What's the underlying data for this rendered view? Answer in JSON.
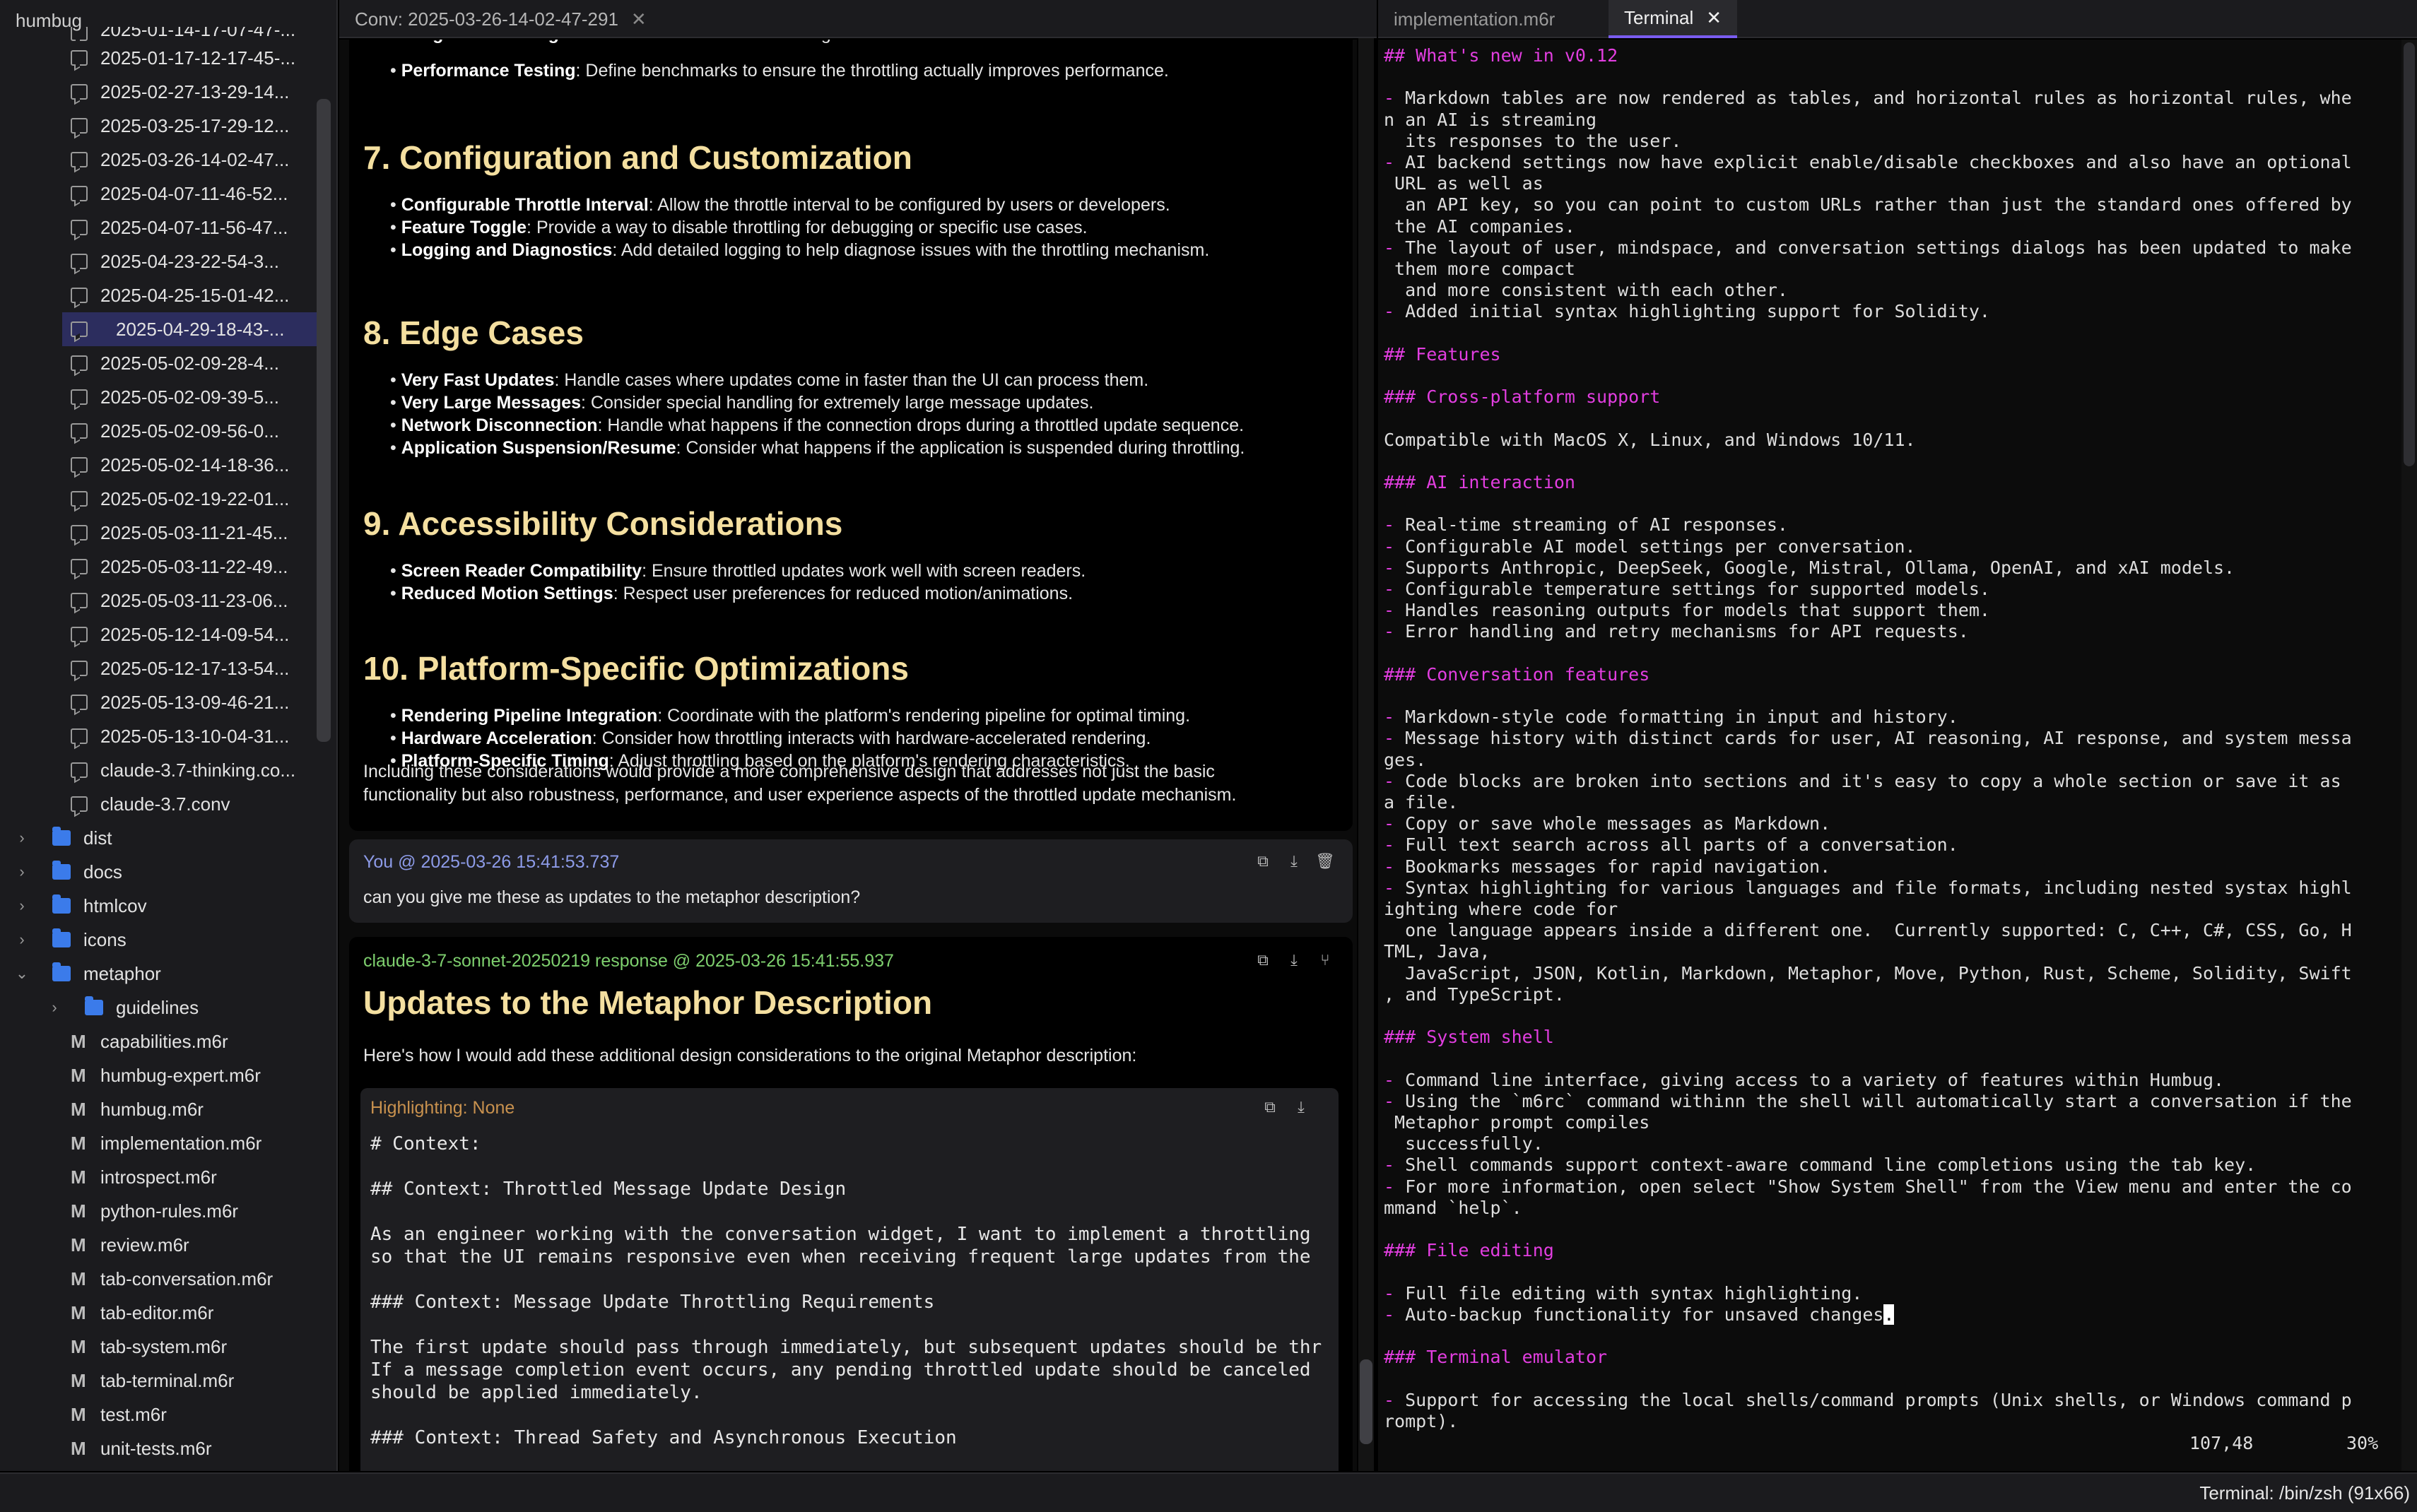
{
  "app": {
    "title": "humbug"
  },
  "sidebar": {
    "conversations": [
      "2025-01-14-17-07-47-...",
      "2025-01-17-12-17-45-...",
      "2025-02-27-13-29-14...",
      "2025-03-25-17-29-12...",
      "2025-03-26-14-02-47...",
      "2025-04-07-11-46-52...",
      "2025-04-07-11-56-47...",
      "2025-04-23-22-54-3...",
      "2025-04-25-15-01-42...",
      "2025-04-29-18-43-...",
      "2025-05-02-09-28-4...",
      "2025-05-02-09-39-5...",
      "2025-05-02-09-56-0...",
      "2025-05-02-14-18-36...",
      "2025-05-02-19-22-01...",
      "2025-05-03-11-21-45...",
      "2025-05-03-11-22-49...",
      "2025-05-03-11-23-06...",
      "2025-05-12-14-09-54...",
      "2025-05-12-17-13-54...",
      "2025-05-13-09-46-21...",
      "2025-05-13-10-04-31...",
      "claude-3.7-thinking.co...",
      "claude-3.7.conv"
    ],
    "folders": [
      "dist",
      "docs",
      "htmlcov",
      "icons"
    ],
    "open_folder": "metaphor",
    "subfolder": "guidelines",
    "files": [
      "capabilities.m6r",
      "humbug-expert.m6r",
      "humbug.m6r",
      "implementation.m6r",
      "introspect.m6r",
      "python-rules.m6r",
      "review.m6r",
      "tab-conversation.m6r",
      "tab-editor.m6r",
      "tab-system.m6r",
      "tab-terminal.m6r",
      "test.m6r",
      "unit-tests.m6r"
    ],
    "file_icon": "M"
  },
  "conv_tab": {
    "label": "Conv: 2025-03-26-14-02-47-291",
    "close": "✕"
  },
  "conversation": {
    "top_bullets": [
      {
        "b": "Integration Testing",
        "t": ": Describe how to test the throttling with the rest of the UI."
      },
      {
        "b": "Performance Testing",
        "t": ": Define benchmarks to ensure the throttling actually improves performance."
      }
    ],
    "sections": [
      {
        "title": "7. Configuration and Customization",
        "bullets": [
          {
            "b": "Configurable Throttle Interval",
            "t": ": Allow the throttle interval to be configured by users or developers."
          },
          {
            "b": "Feature Toggle",
            "t": ": Provide a way to disable throttling for debugging or specific use cases."
          },
          {
            "b": "Logging and Diagnostics",
            "t": ": Add detailed logging to help diagnose issues with the throttling mechanism."
          }
        ]
      },
      {
        "title": "8. Edge Cases",
        "bullets": [
          {
            "b": "Very Fast Updates",
            "t": ": Handle cases where updates come in faster than the UI can process them."
          },
          {
            "b": "Very Large Messages",
            "t": ": Consider special handling for extremely large message updates."
          },
          {
            "b": "Network Disconnection",
            "t": ": Handle what happens if the connection drops during a throttled update sequence."
          },
          {
            "b": "Application Suspension/Resume",
            "t": ": Consider what happens if the application is suspended during throttling."
          }
        ]
      },
      {
        "title": "9. Accessibility Considerations",
        "bullets": [
          {
            "b": "Screen Reader Compatibility",
            "t": ": Ensure throttled updates work well with screen readers."
          },
          {
            "b": "Reduced Motion Settings",
            "t": ": Respect user preferences for reduced motion/animations."
          }
        ]
      },
      {
        "title": "10. Platform-Specific Optimizations",
        "bullets": [
          {
            "b": "Rendering Pipeline Integration",
            "t": ": Coordinate with the platform's rendering pipeline for optimal timing."
          },
          {
            "b": "Hardware Acceleration",
            "t": ": Consider how throttling interacts with hardware-accelerated rendering."
          },
          {
            "b": "Platform-Specific Timing",
            "t": ": Adjust throttling based on the platform's rendering characteristics."
          }
        ]
      }
    ],
    "closing_para_1": "Including these considerations would provide a more comprehensive design that addresses not just the basic",
    "closing_para_2": "functionality but also robustness, performance, and user experience aspects of the throttled update mechanism.",
    "user_message": {
      "meta": "You @ 2025-03-26 15:41:53.737",
      "text": "can you give me these as updates to the metaphor description?"
    },
    "ai_message": {
      "meta": "claude-3-7-sonnet-20250219 response @ 2025-03-26 15:41:55.937",
      "title": "Updates to the Metaphor Description",
      "intro": "Here's how I would add these additional design considerations to the original Metaphor description:",
      "code_header": "Highlighting: None",
      "code_lines": [
        "# Context:",
        "",
        "## Context: Throttled Message Update Design",
        "",
        "As an engineer working with the conversation widget, I want to implement a throttling",
        "so that the UI remains responsive even when receiving frequent large updates from the",
        "",
        "### Context: Message Update Throttling Requirements",
        "",
        "The first update should pass through immediately, but subsequent updates should be thr",
        "If a message completion event occurs, any pending throttled update should be canceled",
        "should be applied immediately.",
        "",
        "### Context: Thread Safety and Asynchronous Execution"
      ]
    }
  },
  "term_tabs": {
    "inactive": "implementation.m6r",
    "active": "Terminal",
    "close": "✕"
  },
  "terminal": {
    "lines": [
      "## What's new in v0.12",
      "",
      "- Markdown tables are now rendered as tables, and horizontal rules as horizontal rules, whe",
      "n an AI is streaming",
      "  its responses to the user.",
      "- AI backend settings now have explicit enable/disable checkboxes and also have an optional",
      " URL as well as",
      "  an API key, so you can point to custom URLs rather than just the standard ones offered by",
      " the AI companies.",
      "- The layout of user, mindspace, and conversation settings dialogs has been updated to make",
      " them more compact",
      "  and more consistent with each other.",
      "- Added initial syntax highlighting support for Solidity.",
      "",
      "## Features",
      "",
      "### Cross-platform support",
      "",
      "Compatible with MacOS X, Linux, and Windows 10/11.",
      "",
      "### AI interaction",
      "",
      "- Real-time streaming of AI responses.",
      "- Configurable AI model settings per conversation.",
      "- Supports Anthropic, DeepSeek, Google, Mistral, Ollama, OpenAI, and xAI models.",
      "- Configurable temperature settings for supported models.",
      "- Handles reasoning outputs for models that support them.",
      "- Error handling and retry mechanisms for API requests.",
      "",
      "### Conversation features",
      "",
      "- Markdown-style code formatting in input and history.",
      "- Message history with distinct cards for user, AI reasoning, AI response, and system messa",
      "ges.",
      "- Code blocks are broken into sections and it's easy to copy a whole section or save it as",
      "a file.",
      "- Copy or save whole messages as Markdown.",
      "- Full text search across all parts of a conversation.",
      "- Bookmarks messages for rapid navigation.",
      "- Syntax highlighting for various languages and file formats, including nested systax highl",
      "ighting where code for",
      "  one language appears inside a different one.  Currently supported: C, C++, C#, CSS, Go, H",
      "TML, Java,",
      "  JavaScript, JSON, Kotlin, Markdown, Metaphor, Move, Python, Rust, Scheme, Solidity, Swift",
      ", and TypeScript.",
      "",
      "### System shell",
      "",
      "- Command line interface, giving access to a variety of features within Humbug.",
      "- Using the `m6rc` command withinn the shell will automatically start a conversation if the",
      " Metaphor prompt compiles",
      "  successfully.",
      "- Shell commands support context-aware command line completions using the tab key.",
      "- For more information, open select \"Show System Shell\" from the View menu and enter the co",
      "mmand `help`.",
      "",
      "### File editing",
      "",
      "- Full file editing with syntax highlighting.",
      "- Auto-backup functionality for unsaved changes.",
      "",
      "### Terminal emulator",
      "",
      "- Support for accessing the local shells/command prompts (Unix shells, or Windows command p",
      "rompt)."
    ],
    "cursor_pos": "107,48",
    "scroll_pct": "30%"
  },
  "statusbar": {
    "text": "Terminal: /bin/zsh (91x66)"
  },
  "colors": {
    "accent": "#7a5cf0",
    "heading": "#f4dfa0",
    "md_heading": "#e23ee0",
    "user_meta": "#8d9be8",
    "ai_meta": "#7ecf6e"
  }
}
